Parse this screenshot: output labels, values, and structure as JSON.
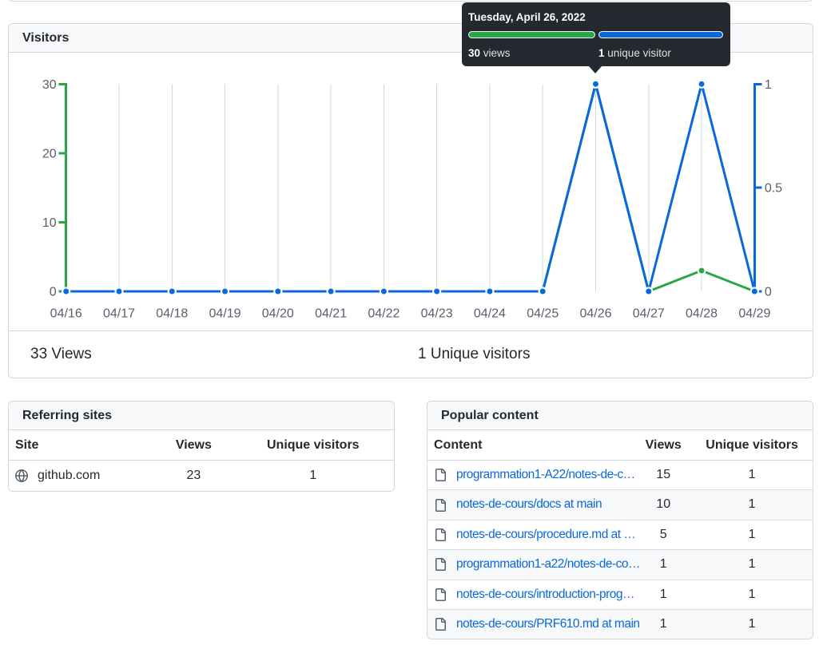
{
  "colors": {
    "panel_border": "#d0d7de",
    "panel_header_bg": "#f6f8fa",
    "text": "#24292f",
    "axis_label": "#57606a",
    "link": "#0969da",
    "views_green": "#28a745",
    "unique_blue": "#0969da",
    "tooltip_bg": "#24292f",
    "gridline": "#d0d7de",
    "row_stripe": "#f6f8fa"
  },
  "visitors_panel": {
    "title": "Visitors",
    "summary_views": "33 Views",
    "summary_unique": "1 Unique visitors"
  },
  "tooltip": {
    "date": "Tuesday, April 26, 2022",
    "views_value": "30",
    "views_label": "views",
    "unique_value": "1",
    "unique_label": "unique visitor"
  },
  "chart_data": {
    "type": "line",
    "title": "Visitors",
    "x": [
      "04/16",
      "04/17",
      "04/18",
      "04/19",
      "04/20",
      "04/21",
      "04/22",
      "04/23",
      "04/24",
      "04/25",
      "04/26",
      "04/27",
      "04/28",
      "04/29"
    ],
    "series": [
      {
        "name": "Views",
        "axis": "left",
        "color": "#28a745",
        "values": [
          0,
          0,
          0,
          0,
          0,
          0,
          0,
          0,
          0,
          0,
          30,
          0,
          3,
          0
        ]
      },
      {
        "name": "Unique visitors",
        "axis": "right",
        "color": "#0969da",
        "values": [
          0,
          0,
          0,
          0,
          0,
          0,
          0,
          0,
          0,
          0,
          1,
          0,
          1,
          0
        ]
      }
    ],
    "left_axis": {
      "ticks": [
        0,
        10,
        20,
        30
      ],
      "range": [
        0,
        30
      ],
      "color": "#28a745"
    },
    "right_axis": {
      "ticks": [
        0,
        0.5,
        1
      ],
      "tick_labels": [
        "0",
        "0.5",
        "1"
      ],
      "range": [
        0,
        1
      ],
      "color": "#0969da"
    },
    "grid": "vertical",
    "legend": "none",
    "highlighted_point": {
      "x": "04/26",
      "views": 30,
      "unique_visitors": 1
    }
  },
  "referring_sites": {
    "title": "Referring sites",
    "columns": [
      "Site",
      "Views",
      "Unique visitors"
    ],
    "rows": [
      {
        "site": "github.com",
        "views": "23",
        "unique_visitors": "1"
      }
    ]
  },
  "popular_content": {
    "title": "Popular content",
    "columns": [
      "Content",
      "Views",
      "Unique visitors"
    ],
    "rows": [
      {
        "content": "programmation1-A22/notes-de-c…",
        "views": "15",
        "unique_visitors": "1"
      },
      {
        "content": "notes-de-cours/docs at main",
        "views": "10",
        "unique_visitors": "1"
      },
      {
        "content": "notes-de-cours/procedure.md at …",
        "views": "5",
        "unique_visitors": "1"
      },
      {
        "content": "programmation1-a22/notes-de-co…",
        "views": "1",
        "unique_visitors": "1"
      },
      {
        "content": "notes-de-cours/introduction-prog…",
        "views": "1",
        "unique_visitors": "1"
      },
      {
        "content": "notes-de-cours/PRF610.md at main",
        "views": "1",
        "unique_visitors": "1"
      }
    ]
  }
}
